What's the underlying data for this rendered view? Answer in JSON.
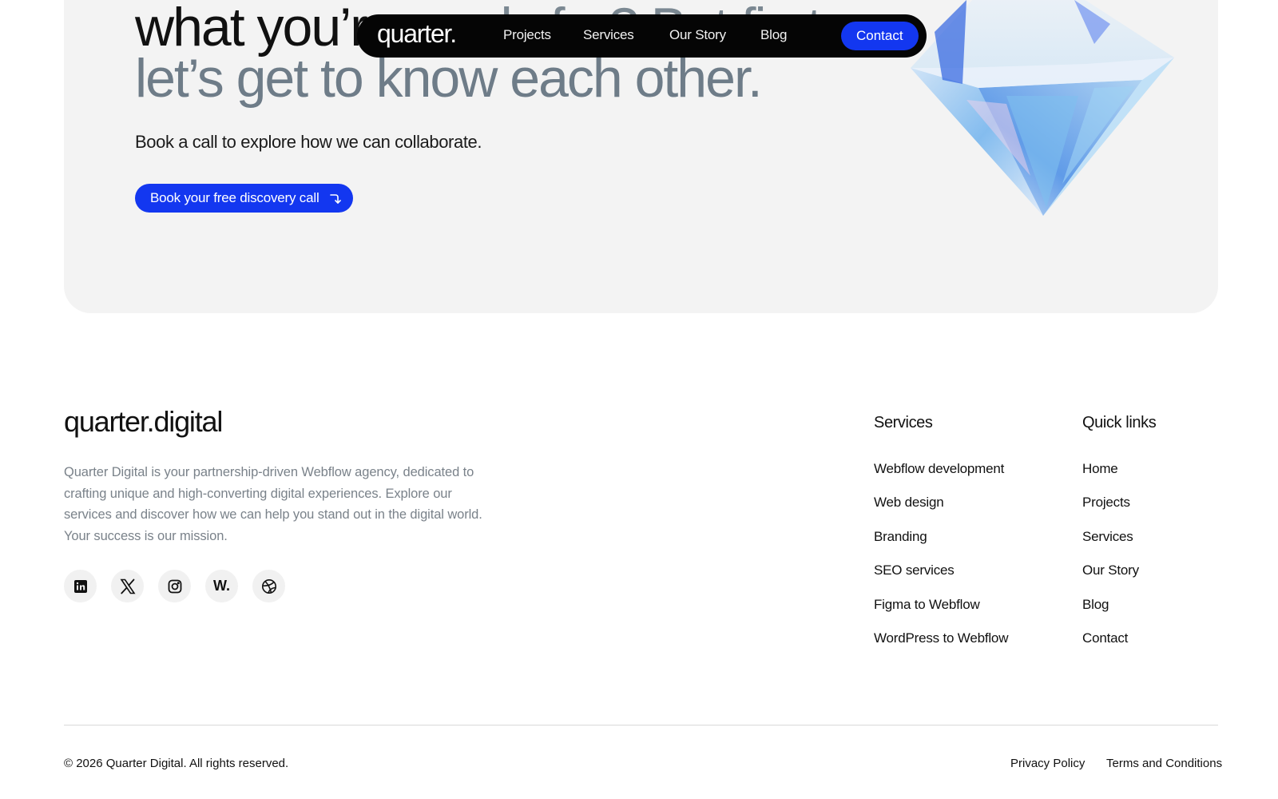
{
  "hero": {
    "line1_dark": "what you’re",
    "line1_muted": " ready for? But first,",
    "line2": "let’s get to know each other.",
    "subtitle": "Book a call to explore how we can collaborate.",
    "cta_label": "Book your free discovery call",
    "cta_icon": "arrow-down-right-icon"
  },
  "nav": {
    "logo": "quarter.",
    "links": [
      "Projects",
      "Services",
      "Our Story",
      "Blog"
    ],
    "contact_label": "Contact"
  },
  "footer": {
    "brand": "quarter.digital",
    "about": "Quarter Digital is your partnership-driven Webflow agency, dedicated to crafting unique and high-converting digital experiences. Explore our services and discover how we can help you stand out in the digital world. Your success is our mission.",
    "socials": [
      {
        "icon": "linkedin-icon"
      },
      {
        "icon": "x-icon"
      },
      {
        "icon": "instagram-icon"
      },
      {
        "icon": "webflow-icon",
        "text": "W."
      },
      {
        "icon": "dribbble-icon"
      }
    ],
    "services": {
      "title": "Services",
      "items": [
        "Webflow development",
        "Web design",
        "Branding",
        "SEO services",
        "Figma to Webflow",
        "WordPress to Webflow"
      ]
    },
    "quick_links": {
      "title": "Quick links",
      "items": [
        "Home",
        "Projects",
        "Services",
        "Our Story",
        "Blog",
        "Contact"
      ]
    },
    "copyright": "© 2026 Quarter Digital. All rights reserved.",
    "privacy": "Privacy Policy",
    "terms": "Terms and Conditions"
  },
  "colors": {
    "accent": "#1337f0",
    "nav_bg": "#050505",
    "hero_bg": "#f3f3f3",
    "muted_text": "#6e7c88"
  }
}
